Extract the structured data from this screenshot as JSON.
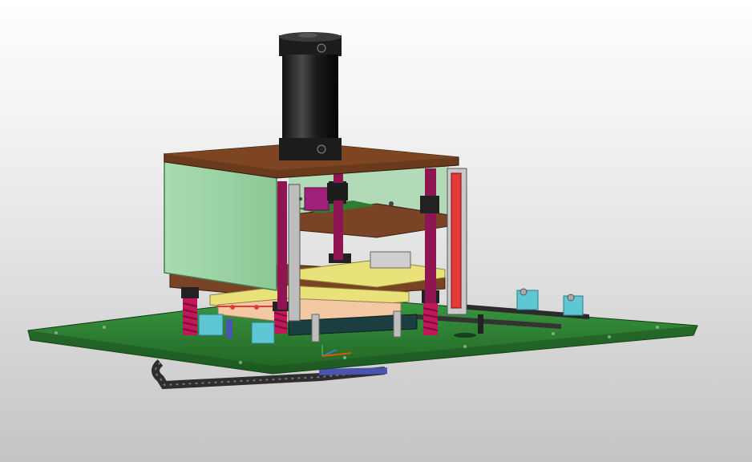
{
  "viewport": {
    "background_top": "#ffffff",
    "background_bottom": "#c4c4c4",
    "model_colors": {
      "base_plate": "#2e7d32",
      "side_panel": "#9fd4a6",
      "top_plate": "#6b3a1c",
      "cylinder": "#2a2a2a",
      "guide_post": "#8e1552",
      "spring": "#c2185b",
      "red_rail": "#e53935",
      "yellow_fixture": "#e9e27a",
      "cyan_block": "#5fc7d3",
      "cable_chain": "#3a3a3a",
      "blue_bar": "#4a55b0"
    },
    "icons": [
      "triad-axis-icon"
    ]
  }
}
